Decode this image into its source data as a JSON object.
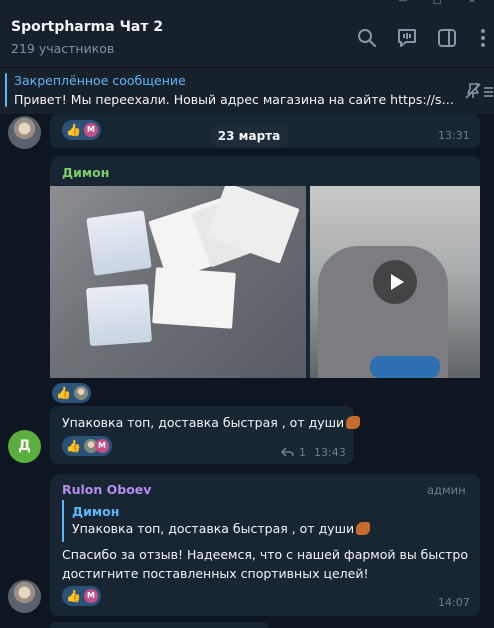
{
  "header": {
    "title": "Sportpharma Чат 2",
    "subtitle": "219 участников",
    "icons": [
      "search-icon",
      "video-chat-icon",
      "sidebar-icon",
      "more-icon"
    ]
  },
  "pinned": {
    "title": "Закреплённое сообщение",
    "text": "Привет! Мы переехали. Новый адрес магазина на сайте https://sportpharma..."
  },
  "messages": [
    {
      "reactions": [
        {
          "emoji": "👍",
          "avatar": "М"
        }
      ],
      "time": "13:31"
    },
    {
      "date_separator": "23 марта"
    },
    {
      "sender": "Димон",
      "media": [
        "photo",
        "video"
      ],
      "reactions": [
        {
          "emoji": "👍",
          "avatar": "photo"
        }
      ]
    },
    {
      "avatar_letter": "Д",
      "text": "Упаковка топ, доставка быстрая , от души",
      "reactions": [
        {
          "emoji": "👍",
          "avatars": [
            "photo",
            "М"
          ]
        }
      ],
      "reply_count": "1",
      "time": "13:43"
    },
    {
      "sender": "Rulon Oboev",
      "badge": "админ",
      "reply_to": {
        "name": "Димон",
        "text": "Упаковка топ, доставка быстрая , от души"
      },
      "text_line1": "Спасибо за отзыв! Надеемся, что с нашей фармой вы быстро",
      "text_line2": "достигните поставленных спортивных целей!",
      "reactions": [
        {
          "emoji": "👍",
          "avatar": "М"
        }
      ],
      "time": "14:07"
    }
  ],
  "colors": {
    "background": "#0e1621",
    "header": "#17212b",
    "bubble": "#182533",
    "accent": "#5eb5f7",
    "sender_dimon": "#7ecb6a",
    "sender_rulon": "#b48cf0",
    "reaction_pill": "#2b5278"
  }
}
